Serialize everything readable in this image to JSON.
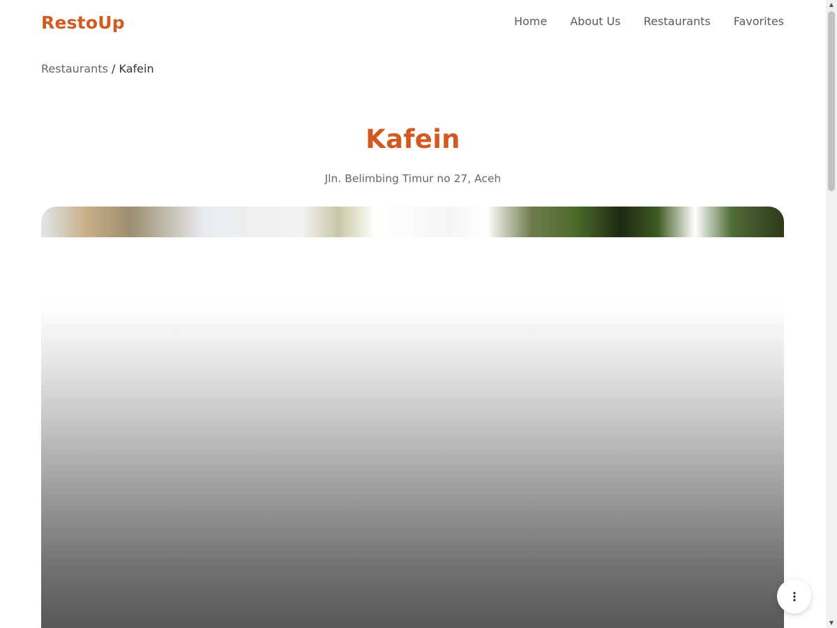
{
  "header": {
    "brand": "RestoUp",
    "nav": [
      {
        "label": "Home"
      },
      {
        "label": "About Us"
      },
      {
        "label": "Restaurants"
      },
      {
        "label": "Favorites"
      }
    ]
  },
  "breadcrumb": {
    "parent": "Restaurants",
    "separator": "/",
    "current": "Kafein"
  },
  "restaurant": {
    "name": "Kafein",
    "address": "Jln. Belimbing Timur no 27, Aceh",
    "image_alt": "Kafein"
  },
  "fab": {
    "icon": "more-vertical-icon"
  },
  "colors": {
    "accent": "#d2591f",
    "nav_text": "#5a5a5a",
    "muted_text": "#666666"
  }
}
